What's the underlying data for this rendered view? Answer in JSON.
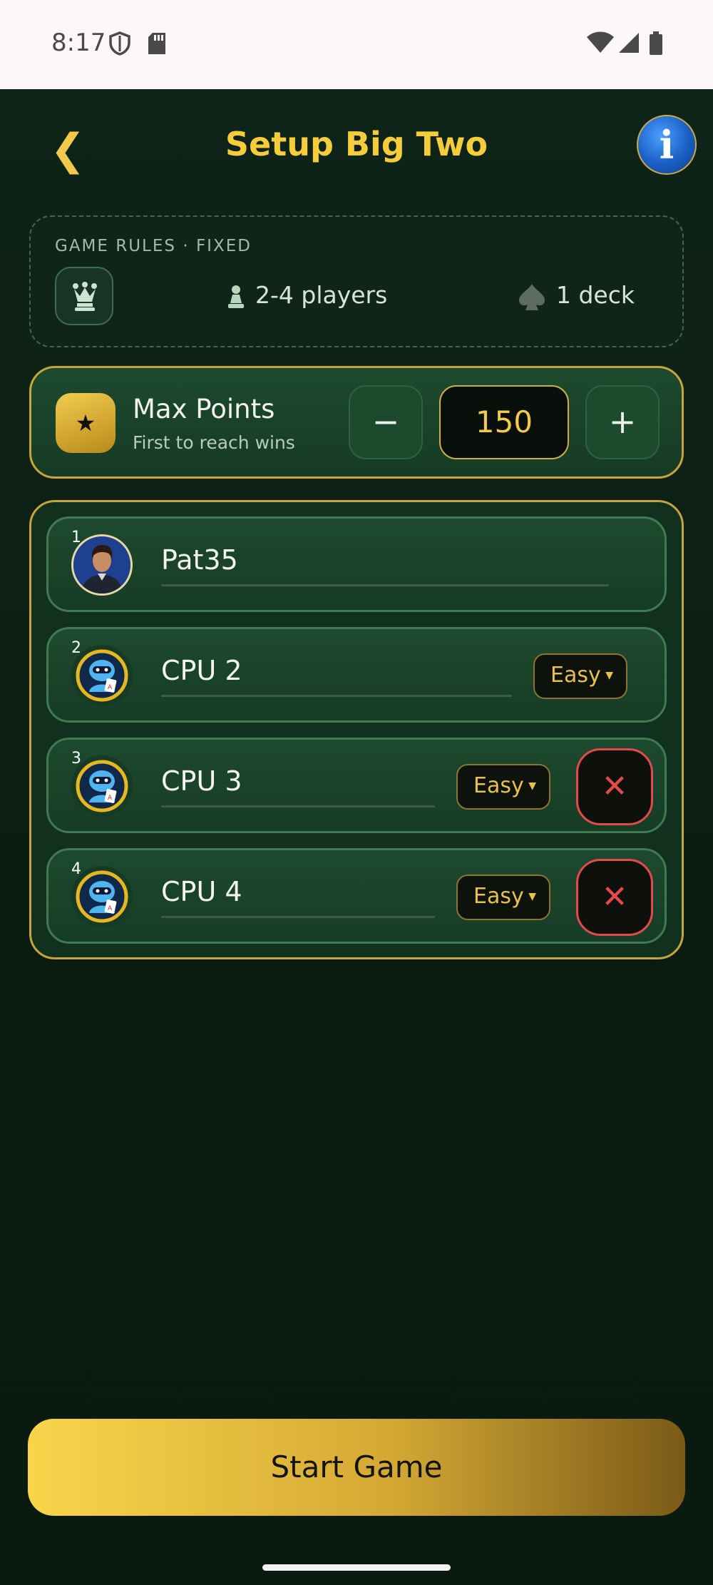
{
  "status_bar": {
    "time": "8:17"
  },
  "header": {
    "back": "❮",
    "title": "Setup Big Two",
    "info": "i"
  },
  "rules": {
    "heading": "GAME RULES · FIXED",
    "players": "2-4 players",
    "deck": "1 deck"
  },
  "max_points": {
    "title": "Max Points",
    "subtitle": "First to reach wins",
    "star": "★",
    "minus": "−",
    "value": "150",
    "plus": "+"
  },
  "players": [
    {
      "number": "1",
      "name": "Pat35"
    },
    {
      "number": "2",
      "name": "CPU 2",
      "difficulty": "Easy"
    },
    {
      "number": "3",
      "name": "CPU 3",
      "difficulty": "Easy",
      "remove": "✕"
    },
    {
      "number": "4",
      "name": "CPU 4",
      "difficulty": "Easy",
      "remove": "✕"
    }
  ],
  "start_button": "Start Game",
  "colors": {
    "accent": "#f5cc3a",
    "danger": "#e34a4a",
    "bg": "#0b1c12"
  }
}
